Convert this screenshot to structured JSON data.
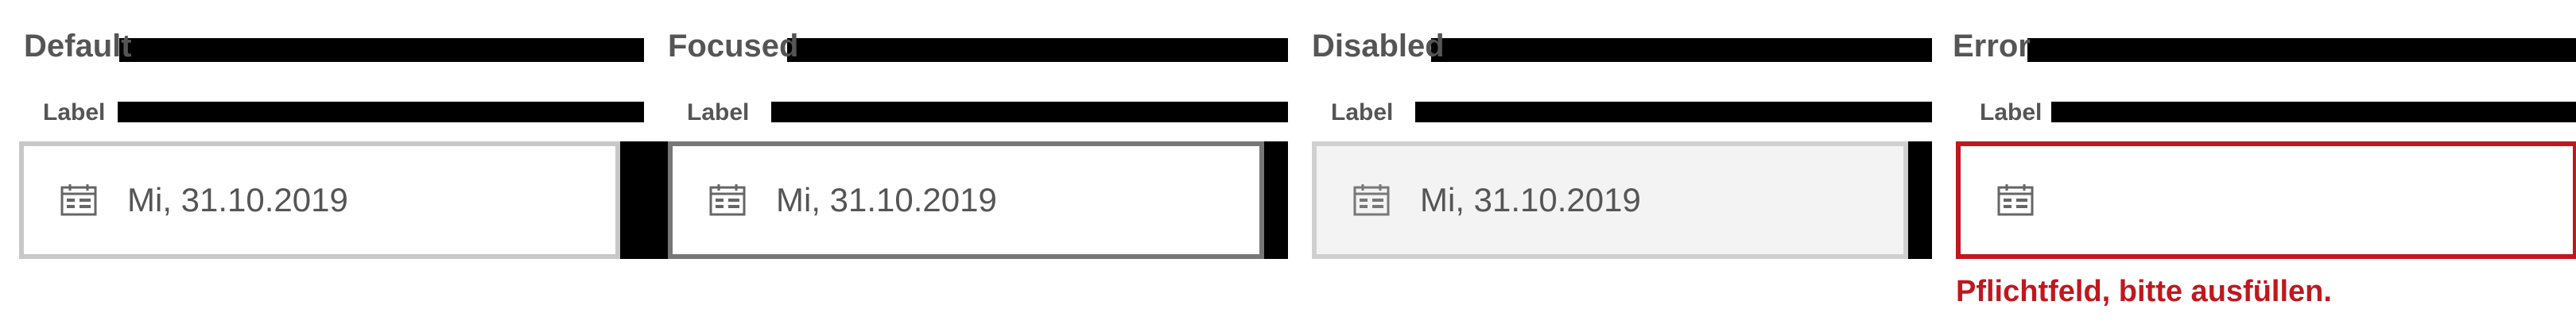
{
  "colors": {
    "text": "#555555",
    "error": "#c0181e",
    "border_default": "#c8c8c8",
    "border_focused": "#777777",
    "disabled_bg": "#f3f3f3"
  },
  "states": [
    {
      "title": "Default",
      "label": "Label",
      "value": "Mi, 31.10.2019",
      "icon": "calendar-icon"
    },
    {
      "title": "Focused",
      "label": "Label",
      "value": "Mi, 31.10.2019",
      "icon": "calendar-icon"
    },
    {
      "title": "Disabled",
      "label": "Label",
      "value": "Mi, 31.10.2019",
      "icon": "calendar-icon"
    },
    {
      "title": "Error",
      "label": "Label",
      "value": "",
      "icon": "calendar-icon",
      "error_message": "Pflichtfeld, bitte ausfüllen."
    }
  ]
}
